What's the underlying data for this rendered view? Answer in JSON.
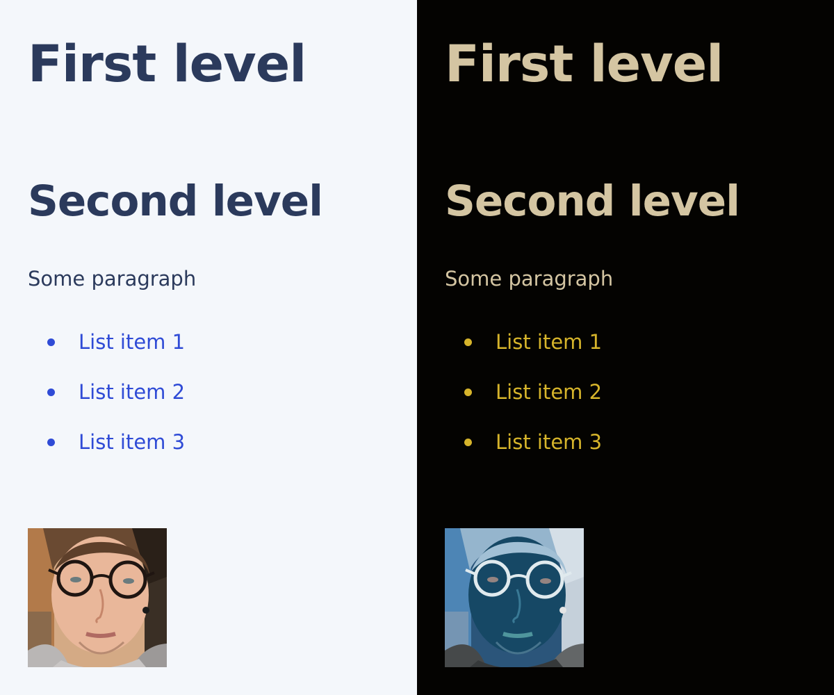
{
  "light_panel": {
    "heading_1": "First level",
    "heading_2": "Second level",
    "paragraph": "Some paragraph",
    "list_items": [
      "List item 1",
      "List item 2",
      "List item 3"
    ],
    "colors": {
      "background": "#f4f7fb",
      "text": "#2b3a5c",
      "list": "#2f4bd6"
    }
  },
  "dark_panel": {
    "heading_1": "First level",
    "heading_2": "Second level",
    "paragraph": "Some paragraph",
    "list_items": [
      "List item 1",
      "List item 2",
      "List item 3"
    ],
    "colors": {
      "background": "#040301",
      "text": "#d4c5a2",
      "list": "#d6b42b"
    }
  }
}
